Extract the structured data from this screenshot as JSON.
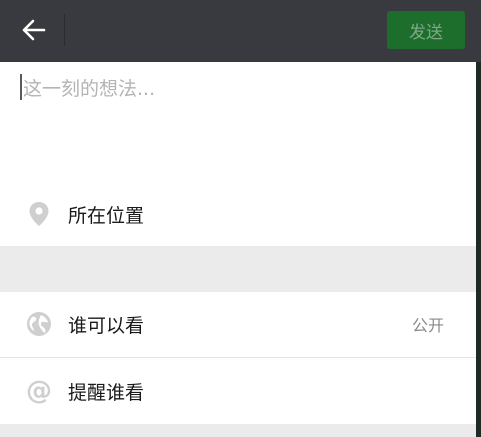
{
  "header": {
    "send_label": "发送"
  },
  "compose": {
    "placeholder": "这一刻的想法..."
  },
  "options": {
    "location_label": "所在位置",
    "visibility_label": "谁可以看",
    "visibility_value": "公开",
    "mention_label": "提醒谁看"
  },
  "icons": {
    "back": "arrow-left-icon",
    "location": "location-pin-icon",
    "visibility": "globe-icon",
    "mention": "at-sign-icon"
  },
  "colors": {
    "header_bg": "#393a3f",
    "send_button_bg": "#1d6e2d",
    "send_button_text": "#7fa887",
    "icon_gray": "#cfcfcf"
  }
}
